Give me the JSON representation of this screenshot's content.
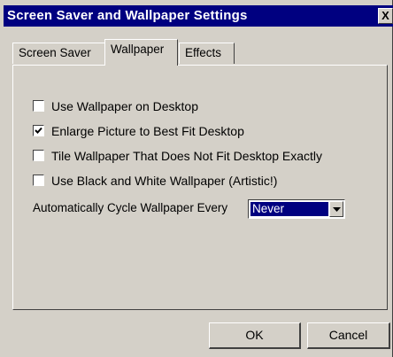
{
  "window": {
    "title": "Screen Saver and Wallpaper Settings",
    "close_label": "X"
  },
  "tabs": [
    {
      "label": "Screen Saver",
      "active": false
    },
    {
      "label": "Wallpaper",
      "active": true
    },
    {
      "label": "Effects",
      "active": false
    }
  ],
  "options": [
    {
      "label": "Use Wallpaper on Desktop",
      "checked": false
    },
    {
      "label": "Enlarge Picture to Best Fit Desktop",
      "checked": true
    },
    {
      "label": "Tile Wallpaper That Does Not Fit Desktop Exactly",
      "checked": false
    },
    {
      "label": "Use Black and White Wallpaper (Artistic!)",
      "checked": false
    }
  ],
  "cycle": {
    "label": "Automatically Cycle Wallpaper Every",
    "selected": "Never"
  },
  "buttons": {
    "ok": "OK",
    "cancel": "Cancel"
  },
  "colors": {
    "titlebar": "#000080",
    "face": "#d4d0c8",
    "highlight": "#000080"
  },
  "icons": {
    "close": "close-icon",
    "checkmark": "checkmark-icon",
    "dropdown": "chevron-down-icon"
  }
}
